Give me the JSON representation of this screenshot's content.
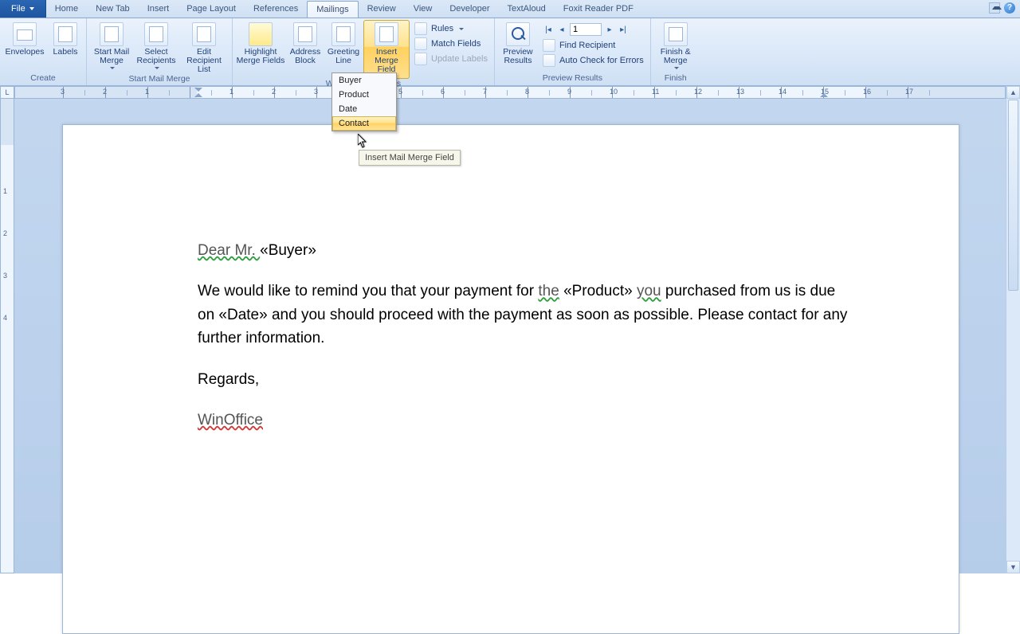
{
  "tabs": {
    "file": "File",
    "items": [
      "Home",
      "New Tab",
      "Insert",
      "Page Layout",
      "References",
      "Mailings",
      "Review",
      "View",
      "Developer",
      "TextAloud",
      "Foxit Reader PDF"
    ],
    "active_index": 5
  },
  "ribbon": {
    "create": {
      "label": "Create",
      "envelopes": "Envelopes",
      "labels": "Labels"
    },
    "start": {
      "label": "Start Mail Merge",
      "start_mail_merge": "Start Mail\nMerge",
      "select_recipients": "Select\nRecipients",
      "edit_recipient_list": "Edit\nRecipient List"
    },
    "write": {
      "label": "Write & Insert Fields",
      "highlight": "Highlight\nMerge Fields",
      "address_block": "Address\nBlock",
      "greeting_line": "Greeting\nLine",
      "insert_merge_field": "Insert Merge\nField",
      "rules": "Rules",
      "match_fields": "Match Fields",
      "update_labels": "Update Labels"
    },
    "preview": {
      "label": "Preview Results",
      "preview_results": "Preview\nResults",
      "record_value": "1",
      "find_recipient": "Find Recipient",
      "auto_check": "Auto Check for Errors"
    },
    "finish": {
      "label": "Finish",
      "finish_merge": "Finish &\nMerge"
    }
  },
  "dropdown": {
    "items": [
      "Buyer",
      "Product",
      "Date",
      "Contact"
    ],
    "hover_index": 3
  },
  "tooltip": "Insert Mail Merge Field",
  "ruler": {
    "corner": "L",
    "h_numbers": [
      "3",
      "2",
      "1",
      "",
      "1",
      "2",
      "3",
      "4",
      "5",
      "6",
      "7",
      "8",
      "9",
      "10",
      "11",
      "12",
      "13",
      "14",
      "15",
      "16",
      "17"
    ],
    "v_numbers": [
      "",
      "1",
      "2",
      "3",
      "4"
    ]
  },
  "doc": {
    "greeting_pre": "Dear Mr. ",
    "greeting_field": "«Buyer»",
    "p1a": "We would like to remind you that your payment for ",
    "p1_the": "the",
    "p1_space": " ",
    "p1_product": "«Product»",
    "p1_space2": " ",
    "p1_you": "you",
    "p1b": " purchased from us is due on ",
    "p1_date": "«Date»",
    "p1c": " and you should proceed with the payment as soon as possible. Please contact   for any further information.",
    "regards": "Regards,",
    "signature": "WinOffice"
  }
}
